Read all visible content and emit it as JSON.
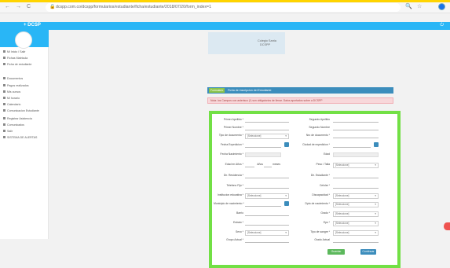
{
  "browser": {
    "back": "←",
    "forward": "→",
    "reload": "C",
    "lock_icon": "lock-icon",
    "url": "dcspp.com.co/dcspp/formularios/estudiante/ficha/estudiante/2018/07/20/form_index=1",
    "zoom_icon": "🔍",
    "star_icon": "☆"
  },
  "app": {
    "title": "+ DCSP",
    "power_icon": "⏻"
  },
  "sidebar": {
    "items": [
      {
        "label": "Mi Inicio / Salir",
        "top": 0
      },
      {
        "label": "Fichas Matricula",
        "top": 0
      },
      {
        "label": "Ficha de estudiante",
        "top": 0
      },
      {
        "label": "Documentos",
        "top": 0
      },
      {
        "label": "Pagos realizados",
        "top": 0
      },
      {
        "label": "Mis cursos",
        "top": 0
      },
      {
        "label": "Mi horario",
        "top": 0
      },
      {
        "label": "Calendario",
        "top": 0
      },
      {
        "label": "Comunicacion Estudiante",
        "top": 0
      },
      {
        "label": "Registrar Asistencia",
        "top": 0
      },
      {
        "label": "Comunicados",
        "top": 0
      },
      {
        "label": "Salir",
        "top": 0
      },
      {
        "label": "SISTEMA DE ALERTAS",
        "top": 0
      }
    ]
  },
  "logo": {
    "line1": "Colegio Santa",
    "line2": "DCSPP"
  },
  "form_header": {
    "badge": "Formulario",
    "text": "Ficha de inscripcion del Estudiante"
  },
  "alert": {
    "text": "Nota: los Campos con asterisco (*) son obligatorios de llenar. Datos aportados sobre a DCSPP"
  },
  "left_fields": [
    "Primer Apellido *",
    "Primer Nombre *",
    "Tipo de documento *",
    "Fecha Expedicion *",
    "Fecha Nacimiento *",
    "Edad en Años *",
    "Dir. Residencia *",
    "Telefono Fijo *",
    "Institucion educativa *",
    "Municipio de nacimiento *",
    "Barrio",
    "Estrato *",
    "Sexo *",
    "Grupo Actual *"
  ],
  "right_fields": [
    "Segundo Apellido",
    "Segundo Nombre",
    "Nro de documento *",
    "Ciudad de expedicion *",
    "Edad",
    "Peso / Talla",
    "Dir. Estudiante *",
    "Celular *",
    "Discapacidad *",
    "Dpto de nacimiento *",
    "Grado *",
    "Eps *",
    "Tipo de sangre *",
    "Grado Actual"
  ],
  "select_placeholder": "[Seleccione]",
  "edad_labels": {
    "years": "Años",
    "months": "meses"
  },
  "buttons": {
    "save": "Guardar",
    "next": "Continuar"
  }
}
